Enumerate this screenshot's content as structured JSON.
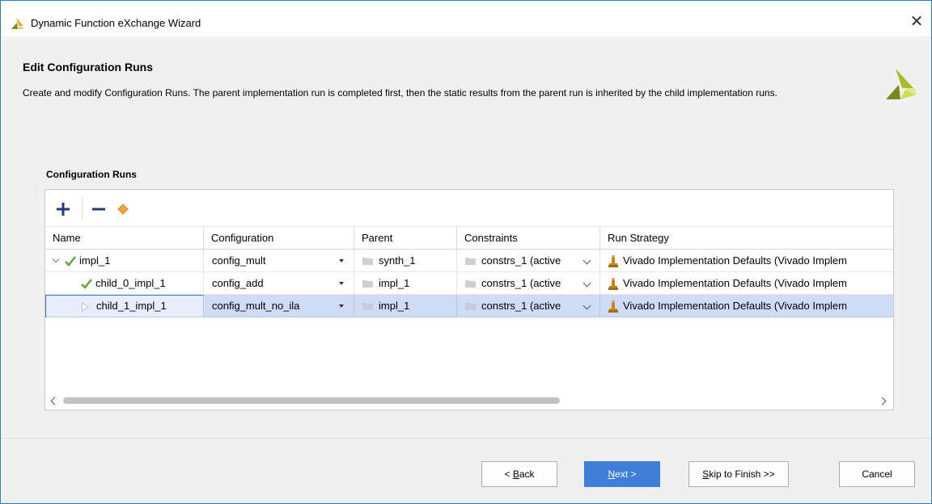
{
  "window": {
    "title": "Dynamic Function eXchange Wizard",
    "close_glyph": "✕"
  },
  "header": {
    "title": "Edit Configuration Runs",
    "description": "Create and modify Configuration Runs. The parent implementation run is completed first, then the static results from the parent run is inherited by the child implementation runs."
  },
  "section": {
    "label": "Configuration Runs"
  },
  "toolbar": {
    "add_icon": "plus-icon",
    "remove_icon": "minus-icon",
    "edit_icon": "diamond-icon"
  },
  "table": {
    "columns": [
      "Name",
      "Configuration",
      "Parent",
      "Constraints",
      "Run Strategy"
    ],
    "rows": [
      {
        "name": "impl_1",
        "status": "complete",
        "expanded": true,
        "configuration": "config_mult",
        "parent": "synth_1",
        "constraints": "constrs_1 (active",
        "strategy": "Vivado Implementation Defaults (Vivado Implem"
      },
      {
        "name": "child_0_impl_1",
        "status": "complete",
        "configuration": "config_add",
        "parent": "impl_1",
        "constraints": "constrs_1 (active",
        "strategy": "Vivado Implementation Defaults (Vivado Implem"
      },
      {
        "name": "child_1_impl_1",
        "status": "not-started",
        "selected": true,
        "configuration": "config_mult_no_ila",
        "parent": "impl_1",
        "constraints": "constrs_1 (active",
        "strategy": "Vivado Implementation Defaults (Vivado Implem"
      }
    ]
  },
  "buttons": {
    "back_prefix": "< ",
    "back_key": "B",
    "back_rest": "ack",
    "next_key": "N",
    "next_rest": "ext >",
    "skip_key": "S",
    "skip_rest": "kip to Finish >>",
    "cancel": "Cancel"
  },
  "colors": {
    "accent": "#3f7fd9",
    "selection": "#cfdcf6",
    "check": "#5aa832",
    "logo_dark": "#7a8a1a",
    "logo_light": "#c8d848"
  }
}
